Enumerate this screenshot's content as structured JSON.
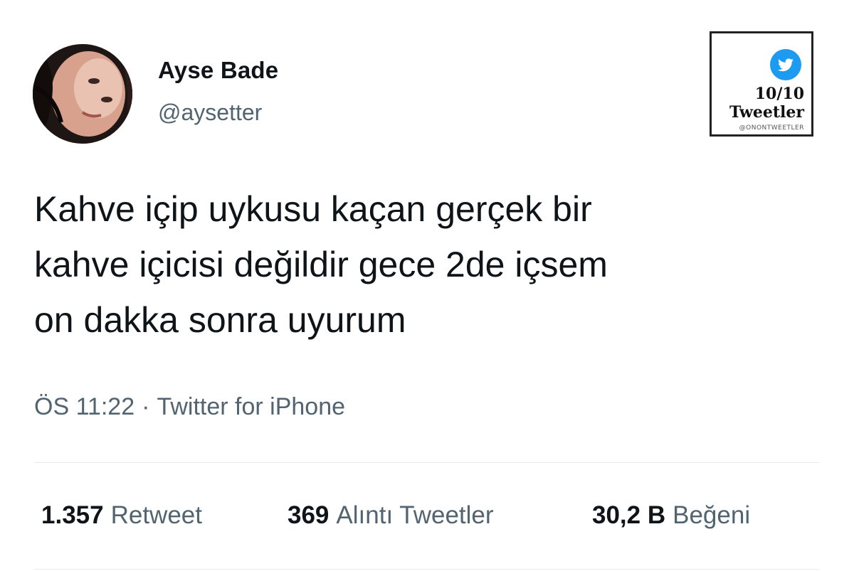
{
  "user": {
    "display_name": "Ayse Bade",
    "handle": "@aysetter"
  },
  "brand": {
    "score": "10/10",
    "tagline": "Tweetler",
    "handle": "@ONONTWEETLER",
    "icon": "twitter-bird-icon",
    "accent_color": "#1d9bf0"
  },
  "tweet": {
    "text": "Kahve içip uykusu kaçan gerçek bir\nkahve içicisi değildir gece 2de içsem\non dakka sonra uyurum",
    "time": "ÖS 11:22",
    "separator": "·",
    "source": "Twitter for iPhone"
  },
  "stats": {
    "retweets": {
      "count": "1.357",
      "label": "Retweet"
    },
    "quotes": {
      "count": "369",
      "label": "Alıntı Tweetler"
    },
    "likes": {
      "count": "30,2 B",
      "label": "Beğeni"
    }
  }
}
